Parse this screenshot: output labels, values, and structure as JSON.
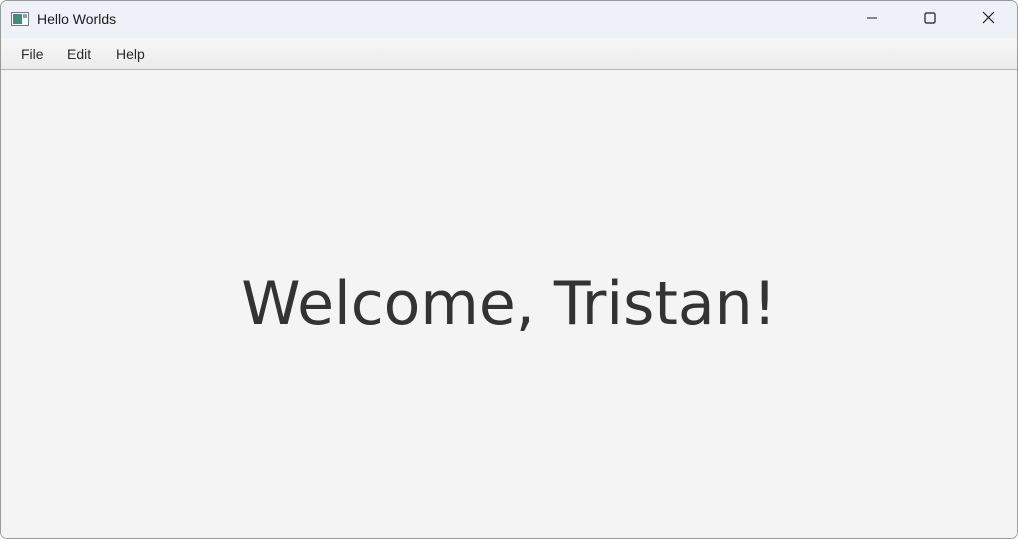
{
  "window": {
    "title": "Hello Worlds",
    "app_icon": "app-window-icon",
    "controls": {
      "minimize_icon": "minimize-icon",
      "maximize_icon": "maximize-icon",
      "close_icon": "close-icon"
    }
  },
  "menubar": {
    "items": [
      {
        "label": "File"
      },
      {
        "label": "Edit"
      },
      {
        "label": "Help"
      }
    ]
  },
  "main": {
    "welcome_text": "Welcome, Tristan!"
  },
  "colors": {
    "titlebar_bg": "#eff1f8",
    "content_bg": "#f4f4f4",
    "text": "#333333"
  }
}
